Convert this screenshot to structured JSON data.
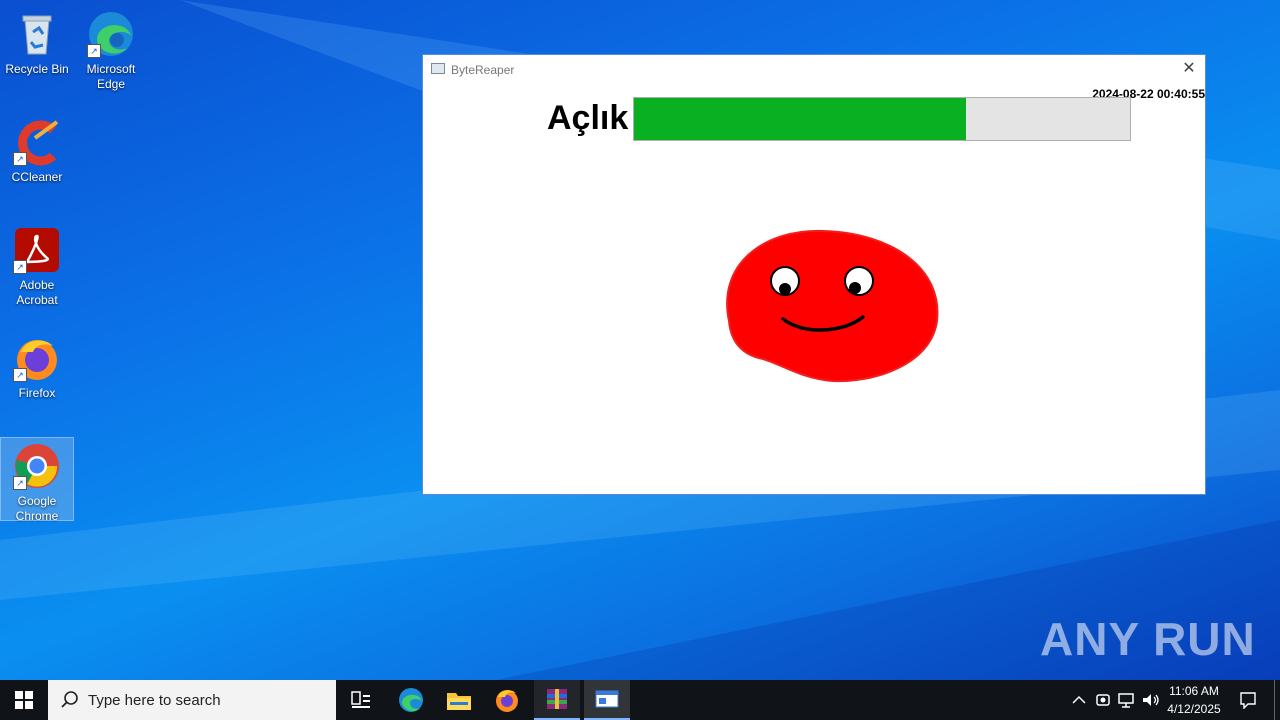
{
  "desktop": {
    "icons": [
      {
        "label": "Recycle Bin"
      },
      {
        "label": "Microsoft Edge"
      },
      {
        "label": "CCleaner"
      },
      {
        "label": "Adobe Acrobat"
      },
      {
        "label": "Firefox"
      },
      {
        "label": "Google Chrome"
      }
    ],
    "watermark": "ANY RUN"
  },
  "window": {
    "title": "ByteReaper",
    "close_glyph": "✕",
    "timestamp": "2024-08-22 00:40:55",
    "hunger_label": "Açlık",
    "hunger_fraction": 0.67,
    "bar_fill_color": "#09b021",
    "pet_color": "#ff0000"
  },
  "taskbar": {
    "search_placeholder": "Type here to search",
    "time": "11:06 AM",
    "date": "4/12/2025",
    "icons": [
      "start-icon",
      "search-icon",
      "task-view-icon",
      "edge-icon",
      "file-explorer-icon",
      "firefox-icon",
      "winrar-icon",
      "app-window-icon",
      "tray-chevron-icon",
      "meet-icon",
      "network-icon",
      "volume-icon",
      "notifications-icon"
    ]
  }
}
